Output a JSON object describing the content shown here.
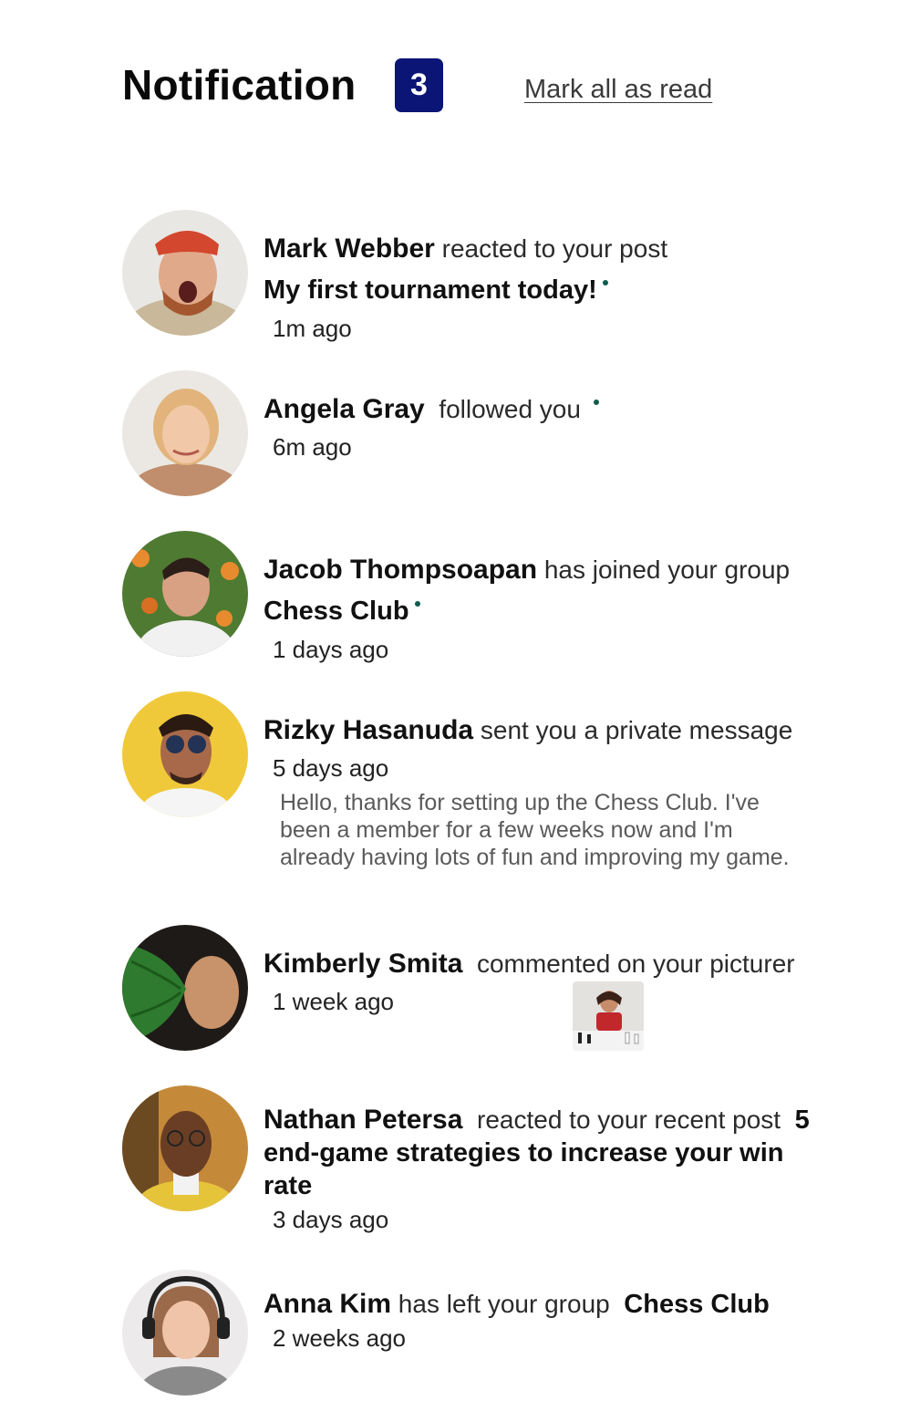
{
  "header": {
    "title": "Notification",
    "unread_count": "3",
    "mark_all_label": "Mark all as read"
  },
  "notifications": [
    {
      "name": "Mark Webber",
      "action": "reacted to your post",
      "target": "My first tournament today!",
      "unread": true,
      "time": "1m ago"
    },
    {
      "name": "Angela Gray",
      "action": "followed you",
      "unread": true,
      "time": "6m ago"
    },
    {
      "name": "Jacob Thompsoapan",
      "action": "has joined your group",
      "target": "Chess Club",
      "unread": true,
      "time": "1 days ago"
    },
    {
      "name": "Rizky Hasanuda",
      "action": "sent you a private message",
      "time": "5 days ago",
      "message": "Hello, thanks for setting up the Chess Club. I've been a member for a few weeks now and I'm already having lots of fun and improving my game."
    },
    {
      "name": "Kimberly Smita",
      "action": "commented on your picturer",
      "time": "1 week ago"
    },
    {
      "name": "Nathan Petersa",
      "action": "reacted to your recent post",
      "target": "5 end-game strategies to increase your win rate",
      "time": "3 days ago"
    },
    {
      "name": "Anna Kim",
      "action": "has left your group",
      "target": "Chess Club",
      "time": "2 weeks ago"
    }
  ],
  "colors": {
    "badge": "#0b1575",
    "unread_dot": "#0d5c4e",
    "message_text": "#5a5a5a"
  }
}
